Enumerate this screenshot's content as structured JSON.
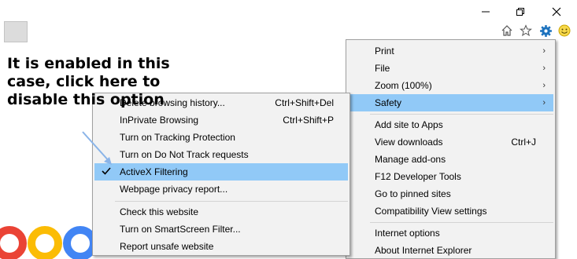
{
  "annotation": {
    "text": "It is enabled in this\ncase, click here to\ndisable this option"
  },
  "tools_menu": {
    "items": [
      {
        "label": "Print",
        "shortcut": "",
        "submenu": true
      },
      {
        "label": "File",
        "shortcut": "",
        "submenu": true
      },
      {
        "label": "Zoom (100%)",
        "shortcut": "",
        "submenu": true
      },
      {
        "label": "Safety",
        "shortcut": "",
        "submenu": true,
        "highlighted": true
      },
      {
        "label": "Add site to Apps",
        "shortcut": ""
      },
      {
        "label": "View downloads",
        "shortcut": "Ctrl+J"
      },
      {
        "label": "Manage add-ons",
        "shortcut": ""
      },
      {
        "label": "F12 Developer Tools",
        "shortcut": ""
      },
      {
        "label": "Go to pinned sites",
        "shortcut": ""
      },
      {
        "label": "Compatibility View settings",
        "shortcut": ""
      },
      {
        "label": "Internet options",
        "shortcut": ""
      },
      {
        "label": "About Internet Explorer",
        "shortcut": ""
      }
    ]
  },
  "safety_menu": {
    "items": [
      {
        "label": "Delete browsing history...",
        "shortcut": "Ctrl+Shift+Del"
      },
      {
        "label": "InPrivate Browsing",
        "shortcut": "Ctrl+Shift+P"
      },
      {
        "label": "Turn on Tracking Protection",
        "shortcut": ""
      },
      {
        "label": "Turn on Do Not Track requests",
        "shortcut": ""
      },
      {
        "label": "ActiveX Filtering",
        "shortcut": "",
        "checked": true,
        "highlighted": true
      },
      {
        "label": "Webpage privacy report...",
        "shortcut": ""
      },
      {
        "label": "Check this website",
        "shortcut": ""
      },
      {
        "label": "Turn on SmartScreen Filter...",
        "shortcut": ""
      },
      {
        "label": "Report unsafe website",
        "shortcut": ""
      }
    ]
  },
  "toolbar_icons": [
    "home-icon",
    "favorites-star-icon",
    "tools-gear-icon",
    "feedback-smiley-icon"
  ],
  "window_controls": [
    "minimize-icon",
    "restore-icon",
    "close-icon"
  ],
  "colors": {
    "highlight": "#91c9f7",
    "menu_background": "#f2f2f2",
    "gear_blue": "#1e73be",
    "annotation_arrow": "#8ab4e8"
  }
}
